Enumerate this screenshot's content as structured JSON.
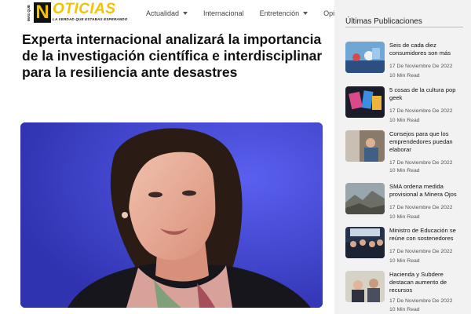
{
  "brand": {
    "side_text": "MÁS QUE",
    "letter": "N",
    "word": "OTICIAS",
    "tagline": "LA VERDAD QUE ESTABAS ESPERANDO",
    "yellow": "#f2c300"
  },
  "nav": {
    "items": [
      {
        "label": "Actualidad",
        "has_dropdown": true
      },
      {
        "label": "Internacional",
        "has_dropdown": false
      },
      {
        "label": "Entretención",
        "has_dropdown": true
      },
      {
        "label": "Opinión",
        "has_dropdown": false
      }
    ]
  },
  "article": {
    "title": "Experta internacional analizará la importancia de la investigación científica e interdisciplinar para la resiliencia ante desastres",
    "hero_background": "#3e45c8"
  },
  "sidebar": {
    "heading": "Últimas Publicaciones",
    "posts": [
      {
        "title": "Seis de cada diez consumidores son más",
        "date": "17 De Noviembre De 2022",
        "read": "10 Min Read"
      },
      {
        "title": "5 cosas de la cultura pop geek",
        "date": "17 De Noviembre De 2022",
        "read": "10 Min Read"
      },
      {
        "title": "Consejos para que los emprendedores puedan elaborar",
        "date": "17 De Noviembre De 2022",
        "read": "10 Min Read"
      },
      {
        "title": "SMA ordena medida provisional a Minera Ojos",
        "date": "17 De Noviembre De 2022",
        "read": "10 Min Read"
      },
      {
        "title": "Ministro de Educación se reúne con sostenedores",
        "date": "17 De Noviembre De 2022",
        "read": "10 Min Read"
      },
      {
        "title": "Hacienda y Subdere destacan aumento de recursos",
        "date": "17 De Noviembre De 2022",
        "read": "10 Min Read"
      }
    ]
  }
}
